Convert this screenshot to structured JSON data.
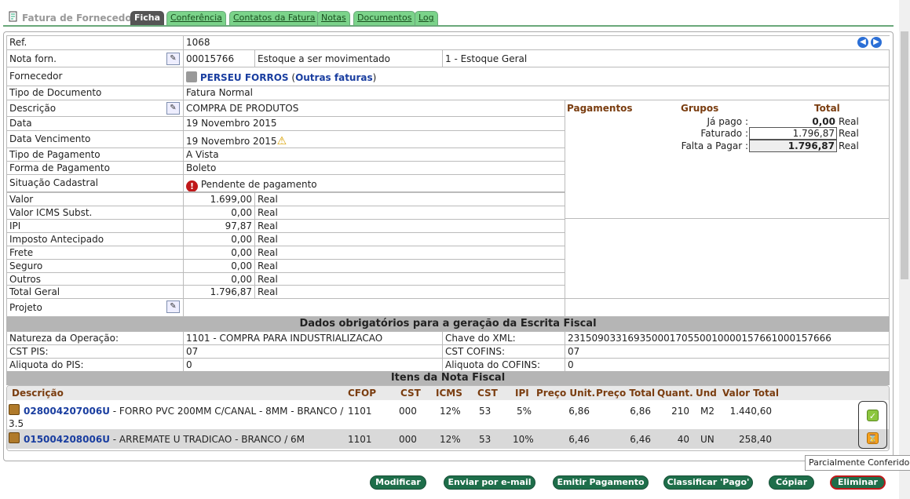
{
  "app": {
    "title": "Fatura de Fornecedor"
  },
  "tabs": [
    "Ficha",
    "Conferência",
    "Contatos da Fatura",
    "Notas",
    "Documentos",
    "Log"
  ],
  "fields": {
    "ref_label": "Ref.",
    "ref_value": "1068",
    "nota_label": "Nota forn.",
    "nota_value": "00015766",
    "estoque_label": "Estoque a ser movimentado",
    "estoque_value": "1 - Estoque Geral",
    "fornecedor_label": "Fornecedor",
    "fornecedor_name": "PERSEU FORROS",
    "outras_open": "(",
    "outras_link": "Outras faturas",
    "outras_close": ")",
    "tipodoc_label": "Tipo de Documento",
    "tipodoc_value": "Fatura Normal",
    "descricao_label": "Descrição",
    "descricao_value": "COMPRA DE PRODUTOS",
    "data_label": "Data",
    "data_value": "19 Novembro 2015",
    "venc_label": "Data Vencimento",
    "venc_value": "19 Novembro 2015",
    "tipopag_label": "Tipo de Pagamento",
    "tipopag_value": "A Vista",
    "formapag_label": "Forma de Pagamento",
    "formapag_value": "Boleto",
    "situacao_label": "Situação Cadastral",
    "situacao_value": "Pendente de pagamento",
    "projeto_label": "Projeto"
  },
  "amounts": [
    {
      "label": "Valor",
      "value": "1.699,00",
      "unit": "Real"
    },
    {
      "label": "Valor ICMS Subst.",
      "value": "0,00",
      "unit": "Real"
    },
    {
      "label": "IPI",
      "value": "97,87",
      "unit": "Real"
    },
    {
      "label": "Imposto Antecipado",
      "value": "0,00",
      "unit": "Real"
    },
    {
      "label": "Frete",
      "value": "0,00",
      "unit": "Real"
    },
    {
      "label": "Seguro",
      "value": "0,00",
      "unit": "Real"
    },
    {
      "label": "Outros",
      "value": "0,00",
      "unit": "Real"
    },
    {
      "label": "Total Geral",
      "value": "1.796,87",
      "unit": "Real"
    }
  ],
  "pagamentos": {
    "h1": "Pagamentos",
    "h2": "Grupos",
    "h3": "Total",
    "ja_label": "Já pago :",
    "ja_value": "0,00",
    "fat_label": "Faturado :",
    "fat_value": "1.796,87",
    "falta_label": "Falta a Pagar :",
    "falta_value": "1.796,87",
    "unit": "Real"
  },
  "fiscal": {
    "title": "Dados obrigatórios para a geração da Escrita Fiscal",
    "natureza_label": "Natureza da Operação:",
    "natureza_value": "1101 - COMPRA PARA INDUSTRIALIZACAO",
    "chave_label": "Chave do XML:",
    "chave_value": "23150903316935000170550010000157661000157666",
    "cstpis_label": "CST PIS:",
    "cstpis_value": "07",
    "cstcofins_label": "CST COFINS:",
    "cstcofins_value": "07",
    "aliqpis_label": "Aliquota do PIS:",
    "aliqpis_value": "0",
    "aliqcofins_label": "Aliquota do COFINS:",
    "aliqcofins_value": "0"
  },
  "items": {
    "title": "Itens da Nota Fiscal",
    "headers": [
      "Descrição",
      "CFOP",
      "CST",
      "ICMS",
      "CST",
      "IPI",
      "Preço Unit.",
      "Preço Total",
      "Quant.",
      "Und",
      "Valor Total"
    ],
    "rows": [
      {
        "code": "028004207006U",
        "desc1": " - FORRO PVC 200MM C/CANAL - 8MM - BRANCO /",
        "desc2": "3.5",
        "cfop": "1101",
        "cst": "000",
        "icms": "12%",
        "cst2": "53",
        "ipi": "5%",
        "unit": "6,86",
        "total": "6,86",
        "qty": "210",
        "und": "M2",
        "vtotal": "1.440,60"
      },
      {
        "code": "015004208006U",
        "desc1": " - ARREMATE U TRADICAO - BRANCO / 6M",
        "desc2": "",
        "cfop": "1101",
        "cst": "000",
        "icms": "12%",
        "cst2": "53",
        "ipi": "10%",
        "unit": "6,46",
        "total": "6,46",
        "qty": "40",
        "und": "UN",
        "vtotal": "258,40"
      }
    ]
  },
  "tooltip": "Parcialmente Conferido",
  "buttons": [
    "Modificar",
    "Enviar por e-mail",
    "Emitir Pagamento",
    "Classificar 'Pago'",
    "Cópiar",
    "Eliminar"
  ]
}
